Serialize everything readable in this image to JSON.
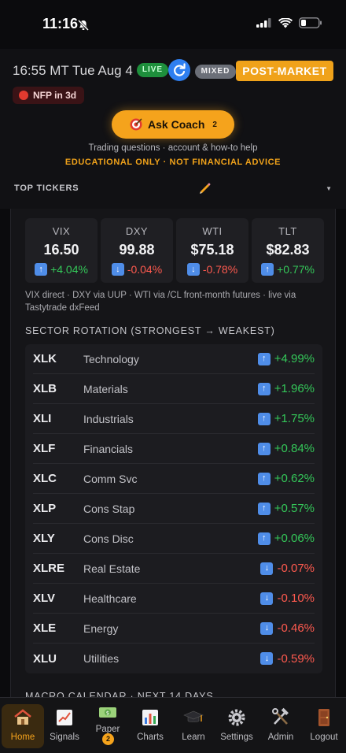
{
  "status_bar": {
    "time": "11:16"
  },
  "header": {
    "datetime": "16:55 MT Tue Aug 4",
    "live_label": "LIVE",
    "mixed_label": "MIXED",
    "session_label": "POST-MARKET",
    "event_badge": "NFP in 3d",
    "coach_button": "Ask Coach",
    "coach_count": "2",
    "subtitle": "Trading questions · account & how-to help",
    "disclaimer": "EDUCATIONAL ONLY · NOT FINANCIAL ADVICE",
    "top_tickers_label": "TOP TICKERS"
  },
  "tiles": [
    {
      "name": "VIX",
      "price": "16.50",
      "change": "+4.04%",
      "direction": "up"
    },
    {
      "name": "DXY",
      "price": "99.88",
      "change": "-0.04%",
      "direction": "down"
    },
    {
      "name": "WTI",
      "price": "$75.18",
      "change": "-0.78%",
      "direction": "down"
    },
    {
      "name": "TLT",
      "price": "$82.83",
      "change": "+0.77%",
      "direction": "up"
    }
  ],
  "source_note": "VIX direct · DXY via UUP · WTI via /CL front-month futures · live via Tastytrade dxFeed",
  "sector_title": "SECTOR ROTATION (STRONGEST → WEAKEST)",
  "sectors": [
    {
      "symbol": "XLK",
      "name": "Technology",
      "change": "+4.99%",
      "direction": "up"
    },
    {
      "symbol": "XLB",
      "name": "Materials",
      "change": "+1.96%",
      "direction": "up"
    },
    {
      "symbol": "XLI",
      "name": "Industrials",
      "change": "+1.75%",
      "direction": "up"
    },
    {
      "symbol": "XLF",
      "name": "Financials",
      "change": "+0.84%",
      "direction": "up"
    },
    {
      "symbol": "XLC",
      "name": "Comm Svc",
      "change": "+0.62%",
      "direction": "up"
    },
    {
      "symbol": "XLP",
      "name": "Cons Stap",
      "change": "+0.57%",
      "direction": "up"
    },
    {
      "symbol": "XLY",
      "name": "Cons Disc",
      "change": "+0.06%",
      "direction": "up"
    },
    {
      "symbol": "XLRE",
      "name": "Real Estate",
      "change": "-0.07%",
      "direction": "down"
    },
    {
      "symbol": "XLV",
      "name": "Healthcare",
      "change": "-0.10%",
      "direction": "down"
    },
    {
      "symbol": "XLE",
      "name": "Energy",
      "change": "-0.46%",
      "direction": "down"
    },
    {
      "symbol": "XLU",
      "name": "Utilities",
      "change": "-0.59%",
      "direction": "down"
    }
  ],
  "macro_peek": "MACRO CALENDAR · NEXT 14 DAYS",
  "tabs": [
    {
      "key": "home",
      "label": "Home"
    },
    {
      "key": "signals",
      "label": "Signals"
    },
    {
      "key": "paper",
      "label": "Paper",
      "badge": "2"
    },
    {
      "key": "charts",
      "label": "Charts"
    },
    {
      "key": "learn",
      "label": "Learn"
    },
    {
      "key": "settings",
      "label": "Settings"
    },
    {
      "key": "admin",
      "label": "Admin"
    },
    {
      "key": "logout",
      "label": "Logout"
    }
  ],
  "colors": {
    "accent": "#f5a31c",
    "up": "#34c759",
    "down": "#ff5a4f",
    "live": "#1e8f3c",
    "refresh": "#2f7ff0"
  }
}
